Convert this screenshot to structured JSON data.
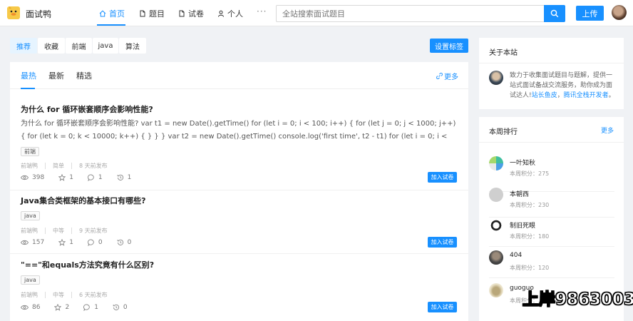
{
  "header": {
    "brand": "面试鸭",
    "nav": [
      {
        "label": "首页",
        "icon": "home-icon"
      },
      {
        "label": "题目",
        "icon": "file-icon"
      },
      {
        "label": "试卷",
        "icon": "file-icon"
      },
      {
        "label": "个人",
        "icon": "user-icon"
      }
    ],
    "more": "···",
    "search_placeholder": "全站搜索面试题目",
    "upload_label": "上传",
    "accent_color": "#1890ff"
  },
  "tags": [
    "推荐",
    "收藏",
    "前端",
    "java",
    "算法"
  ],
  "set_tags_label": "设置标签",
  "tabs": [
    "最热",
    "最新",
    "精选"
  ],
  "more_label": "更多",
  "questions": [
    {
      "title": "为什么 for 循环嵌套顺序会影响性能?",
      "content": "为什么 for 循环嵌套顺序会影响性能? var t1 = new Date().getTime() for (let i = 0; i < 100; i++) { for (let j = 0; j < 1000; j++) { for (let k = 0; k < 10000; k++) { } } } var t2 = new Date().getTime() console.log('first time', t2 - t1) for (let i = 0; i < 10000; i++) { for (let j = 0; j < 1000; j++) { for (let k = 0; k < 10...",
      "tag": "前端",
      "author": "前端鸭",
      "difficulty": "简单",
      "time": "8 天前发布",
      "views": "398",
      "likes": "1",
      "comments": "1",
      "favorites": "1",
      "add_label": "加入试卷"
    },
    {
      "title": "Java集合类框架的基本接口有哪些?",
      "tag": "java",
      "author": "前端鸭",
      "difficulty": "中等",
      "time": "9 天前发布",
      "views": "157",
      "likes": "1",
      "comments": "0",
      "favorites": "0",
      "add_label": "加入试卷"
    },
    {
      "title": "\"==\"和equals方法究竟有什么区别?",
      "tag": "java",
      "author": "前端鸭",
      "difficulty": "中等",
      "time": "6 天前发布",
      "views": "86",
      "likes": "2",
      "comments": "1",
      "favorites": "0",
      "add_label": "加入试卷"
    }
  ],
  "about": {
    "title": "关于本站",
    "text": "致力于收集面试题目与题解，提供一站式面试备战交流服务，助你成为面试达人!",
    "link1": "站长鱼皮",
    "sep": "，",
    "link2": "腾讯全栈开发者",
    "end": "。"
  },
  "ranking": {
    "title": "本周排行",
    "more": "更多",
    "items": [
      {
        "name": "一叶知秋",
        "score": "本周积分：275"
      },
      {
        "name": "本朝西",
        "score": "本周积分：230"
      },
      {
        "name": "制旧死眼",
        "score": "本周积分：180"
      },
      {
        "name": "404",
        "score": "本周积分：120"
      },
      {
        "name": "guoguo",
        "score": "本周积分：..."
      }
    ]
  },
  "watermark": "上岸9863003"
}
